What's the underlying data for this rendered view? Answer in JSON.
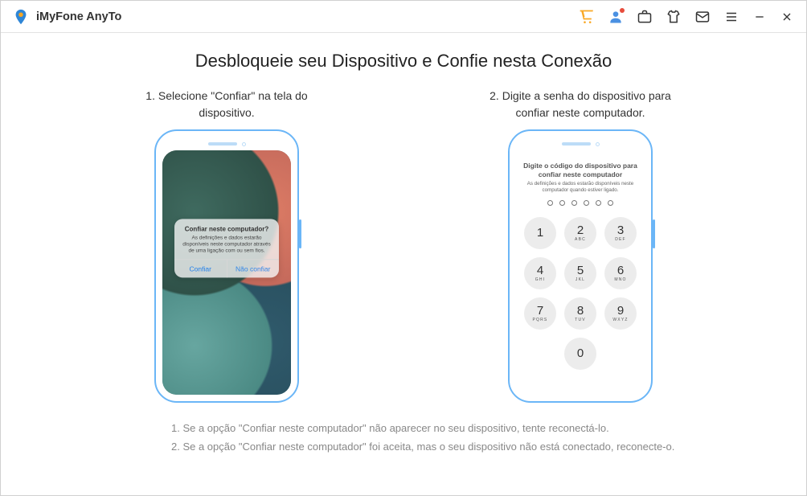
{
  "app": {
    "name": "iMyFone AnyTo"
  },
  "page": {
    "title": "Desbloqueie seu Dispositivo e Confie nesta Conexão",
    "step1": "1. Selecione \"Confiar\" na tela do dispositivo.",
    "step2": "2. Digite a senha do dispositivo para confiar neste computador."
  },
  "dialog": {
    "title": "Confiar neste computador?",
    "body": "As definições e dados estarão disponíveis neste computador através de uma ligação com ou sem fios.",
    "trust": "Confiar",
    "dont": "Não confiar"
  },
  "passcode": {
    "title": "Digite o código do dispositivo para confiar neste computador",
    "sub": "As definições e dados estarão disponíveis neste computador quando estiver ligado.",
    "keys": [
      {
        "n": "1",
        "l": ""
      },
      {
        "n": "2",
        "l": "ABC"
      },
      {
        "n": "3",
        "l": "DEF"
      },
      {
        "n": "4",
        "l": "GHI"
      },
      {
        "n": "5",
        "l": "JKL"
      },
      {
        "n": "6",
        "l": "MNO"
      },
      {
        "n": "7",
        "l": "PQRS"
      },
      {
        "n": "8",
        "l": "TUV"
      },
      {
        "n": "9",
        "l": "WXYZ"
      },
      {
        "n": "",
        "l": ""
      },
      {
        "n": "0",
        "l": ""
      },
      {
        "n": "",
        "l": ""
      }
    ]
  },
  "notes": {
    "n1": "1. Se a opção \"Confiar neste computador\" não aparecer no seu dispositivo, tente reconectá-lo.",
    "n2": "2. Se a opção \"Confiar neste computador\" foi aceita, mas o seu dispositivo não está conectado, reconecte-o."
  }
}
